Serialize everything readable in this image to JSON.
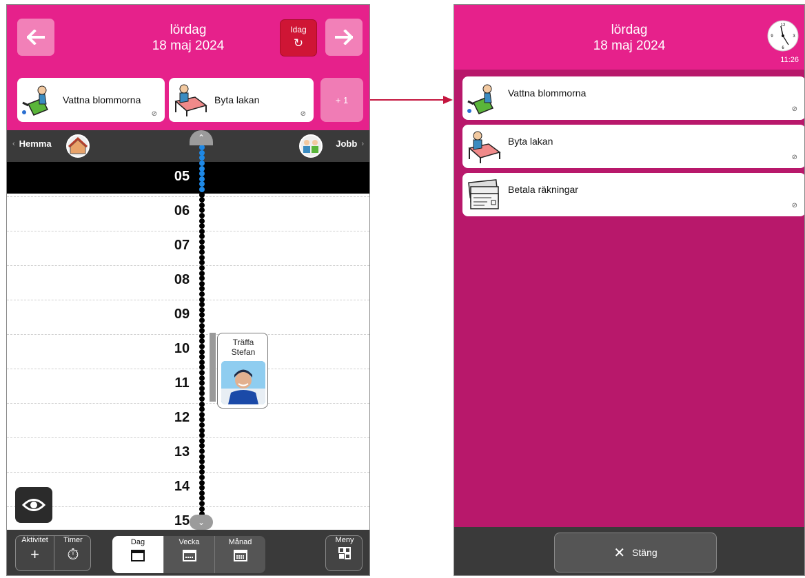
{
  "left": {
    "header": {
      "weekday": "lördag",
      "date": "18 maj 2024",
      "today_label": "Idag"
    },
    "tasks": [
      {
        "label": "Vattna blommorna",
        "icon": "watering-can-icon"
      },
      {
        "label": "Byta lakan",
        "icon": "bed-icon"
      }
    ],
    "more_label": "+ 1",
    "locations": {
      "left": "Hemma",
      "right": "Jobb"
    },
    "hours": [
      "05",
      "06",
      "07",
      "08",
      "09",
      "10",
      "11",
      "12",
      "13",
      "14",
      "15"
    ],
    "event": {
      "title": "Träffa Stefan"
    },
    "toolbar": {
      "activity": "Aktivitet",
      "timer": "Timer",
      "views": [
        "Dag",
        "Vecka",
        "Månad"
      ],
      "menu": "Meny"
    }
  },
  "right": {
    "header": {
      "weekday": "lördag",
      "date": "18 maj 2024",
      "time": "11:26"
    },
    "tasks": [
      {
        "label": "Vattna blommorna",
        "icon": "watering-can-icon"
      },
      {
        "label": "Byta lakan",
        "icon": "bed-icon"
      },
      {
        "label": "Betala räkningar",
        "icon": "bills-icon"
      }
    ],
    "close_label": "Stäng"
  },
  "colors": {
    "header_pink": "#e6218b",
    "panel_magenta": "#b8186b",
    "today_red": "#cf1535",
    "timeline_blue": "#1e88e5",
    "arrow": "#c4163f"
  }
}
